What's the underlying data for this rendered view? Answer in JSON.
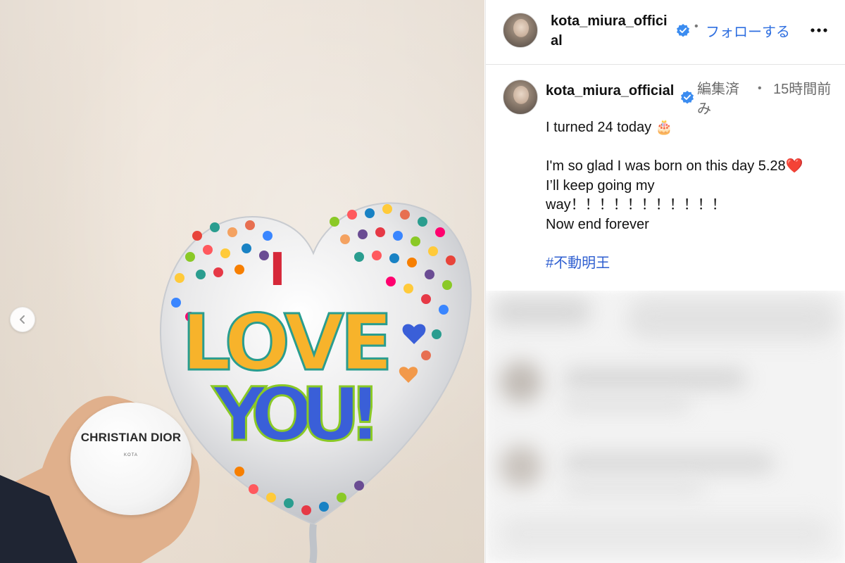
{
  "photo": {
    "prev_icon": "chevron-left-icon",
    "balloon_text": [
      "I",
      "LOVE",
      "YOU!"
    ],
    "product_label": "CHRISTIAN DIOR",
    "product_sub": "KOTA"
  },
  "header": {
    "username": "kota_miura_official",
    "verified_icon": "verified-badge-icon",
    "separator": "•",
    "follow_label": "フォローする",
    "more_icon": "more-horizontal-icon"
  },
  "post": {
    "username": "kota_miura_official",
    "verified_icon": "verified-badge-icon",
    "edited_label": "編集済み",
    "separator": "•",
    "time_label": "15時間前",
    "caption": {
      "line1": "I turned 24 today 🎂",
      "line2": "I'm so glad I was born on this day 5.28❤️",
      "line3": "I’ll keep going my way！！！！！！！！！！！",
      "line4": "Now end forever",
      "hashtag": "#不動明王"
    }
  },
  "colors": {
    "accent": "#2f6fe0",
    "verified": "#3b8cf0",
    "muted_text": "#6b6b6b",
    "hashtag": "#2f5fd0"
  }
}
